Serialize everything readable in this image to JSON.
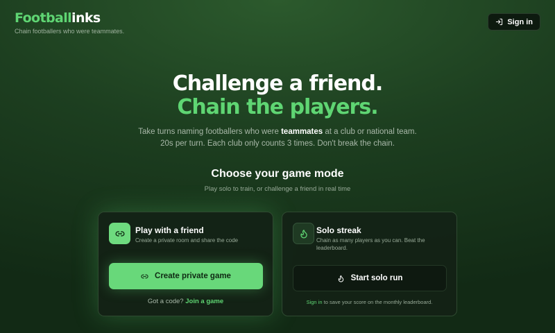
{
  "brand": {
    "logo_part1": "Football",
    "logo_part2": "inks",
    "tagline": "Chain footballers who were teammates."
  },
  "header": {
    "signin_label": "Sign in",
    "signin_icon": "login-icon"
  },
  "hero": {
    "headline_line1": "Challenge a friend.",
    "headline_line2": "Chain the players.",
    "sub_line1_pre": "Take turns naming footballers who were ",
    "sub_line1_bold": "teammates",
    "sub_line1_post": " at a club or national team.",
    "sub_line2": "20s per turn. Each club only counts 3 times. Don't break the chain."
  },
  "mode": {
    "title": "Choose your game mode",
    "subtitle": "Play solo to train, or challenge a friend in real time"
  },
  "cards": {
    "friend": {
      "icon": "link-icon",
      "title": "Play with a friend",
      "description": "Create a private room and share the code",
      "button_label": "Create private game",
      "code_prompt": "Got a code?",
      "join_link": "Join a game"
    },
    "solo": {
      "icon": "flame-icon",
      "title": "Solo streak",
      "description": "Chain as many players as you can. Beat the leaderboard.",
      "button_label": "Start solo run",
      "signin_link": "Sign in",
      "note_rest": "to save your score on the monthly leaderboard."
    }
  },
  "colors": {
    "accent": "#5fd573",
    "background": "#1d3f20",
    "card": "#142216"
  }
}
